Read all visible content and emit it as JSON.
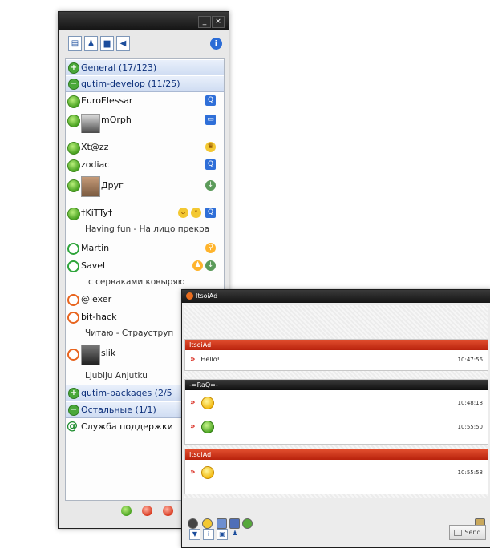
{
  "contact_list": {
    "titlebar": {
      "minimize": "_",
      "close": "×"
    },
    "toolbar": {
      "info": "i"
    },
    "groups": [
      {
        "label": "General (17/123)",
        "toggle": "+"
      },
      {
        "label": "qutim-develop (11/25)",
        "toggle": "−"
      },
      {
        "label": "qutim-packages (2/5",
        "toggle": "+"
      },
      {
        "label": "Остальные (1/1)",
        "toggle": "−"
      }
    ],
    "contacts": [
      {
        "name": "EuroElessar",
        "status": "online",
        "icon": "q"
      },
      {
        "name": "mOrph",
        "status": "online",
        "icon": "chat"
      },
      {
        "name": "Xt@zz",
        "status": "online",
        "icon": "crown"
      },
      {
        "name": "zodiac",
        "status": "online",
        "icon": "q"
      },
      {
        "name": "Друг",
        "status": "online",
        "icon": "down"
      },
      {
        "name": "†KiTTy†",
        "status": "online",
        "icon": "q",
        "status_text": "Having fun - На лицо прекра"
      },
      {
        "name": "Martin",
        "status": "offline",
        "icon": "key"
      },
      {
        "name": "Savel",
        "status": "offline",
        "icon": "down",
        "status_text": "с серваками ковыряю"
      },
      {
        "name": "@lexer",
        "status": "na"
      },
      {
        "name": "bit-hack",
        "status": "na",
        "status_text": "Читаю - Страуструп"
      },
      {
        "name": "slik",
        "status": "na",
        "status_text": "Ljublju Anjutku"
      },
      {
        "name": "Служба поддержки",
        "status": "at"
      }
    ]
  },
  "chat": {
    "title": "ItsoiAd",
    "log": [
      {
        "header": "ItsoiAd",
        "header_style": "red",
        "lines": [
          {
            "text": "Hello!",
            "time": "10:47:56"
          }
        ]
      },
      {
        "header": "-=RaQ=-",
        "header_style": "dark",
        "lines": [
          {
            "text": "",
            "smiley": "yellow",
            "time": "10:48:18"
          },
          {
            "text": "",
            "smiley": "green",
            "time": "10:55:50"
          }
        ]
      },
      {
        "header": "ItsoiAd",
        "header_style": "red",
        "lines": [
          {
            "text": "",
            "smiley": "yellow",
            "time": "10:55:58"
          }
        ]
      }
    ],
    "send_label": "Send"
  },
  "colors": {
    "accent_red": "#d9261a",
    "online_green": "#4aa321",
    "na_orange": "#e8641e",
    "group_blue": "#0c2f7a"
  }
}
